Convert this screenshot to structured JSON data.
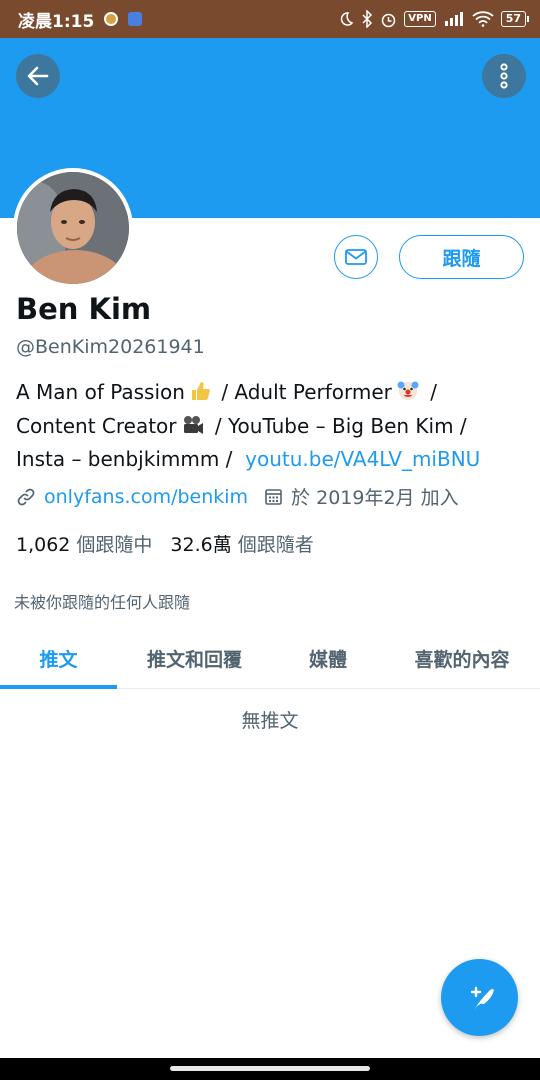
{
  "status_bar": {
    "time": "凌晨1:15",
    "vpn": "VPN",
    "battery": "57"
  },
  "profile": {
    "name": "Ben Kim",
    "handle": "@BenKim20261941",
    "follow_label": "跟隨",
    "bio": {
      "line1_a": "A Man of Passion",
      "line1_b": "/ Adult Performer",
      "line1_c": "/",
      "line2_a": "Content Creator",
      "line2_b": "/ YouTube – Big Ben Kim /",
      "line3_a": "Insta – benbjkimmm /",
      "line3_link": "youtu.be/VA4LV_miBNU"
    },
    "website": "onlyfans.com/benkim",
    "joined": "於 2019年2月 加入",
    "following_count": "1,062",
    "following_label": "個跟隨中",
    "followers_count": "32.6萬",
    "followers_label": "個跟隨者",
    "not_followed_text": "未被你跟隨的任何人跟隨"
  },
  "tabs": [
    {
      "label": "推文",
      "active": true
    },
    {
      "label": "推文和回覆",
      "active": false
    },
    {
      "label": "媒體",
      "active": false
    },
    {
      "label": "喜歡的內容",
      "active": false
    }
  ],
  "empty_state": "無推文",
  "icons": {
    "back": "arrow-left-icon",
    "more": "more-vertical-icon",
    "message": "envelope-icon",
    "link": "link-icon",
    "calendar": "calendar-icon",
    "compose": "feather-plus-icon"
  },
  "colors": {
    "accent": "#1d9bf0",
    "status_bar": "#7a4a2e",
    "secondary_text": "#536471"
  }
}
